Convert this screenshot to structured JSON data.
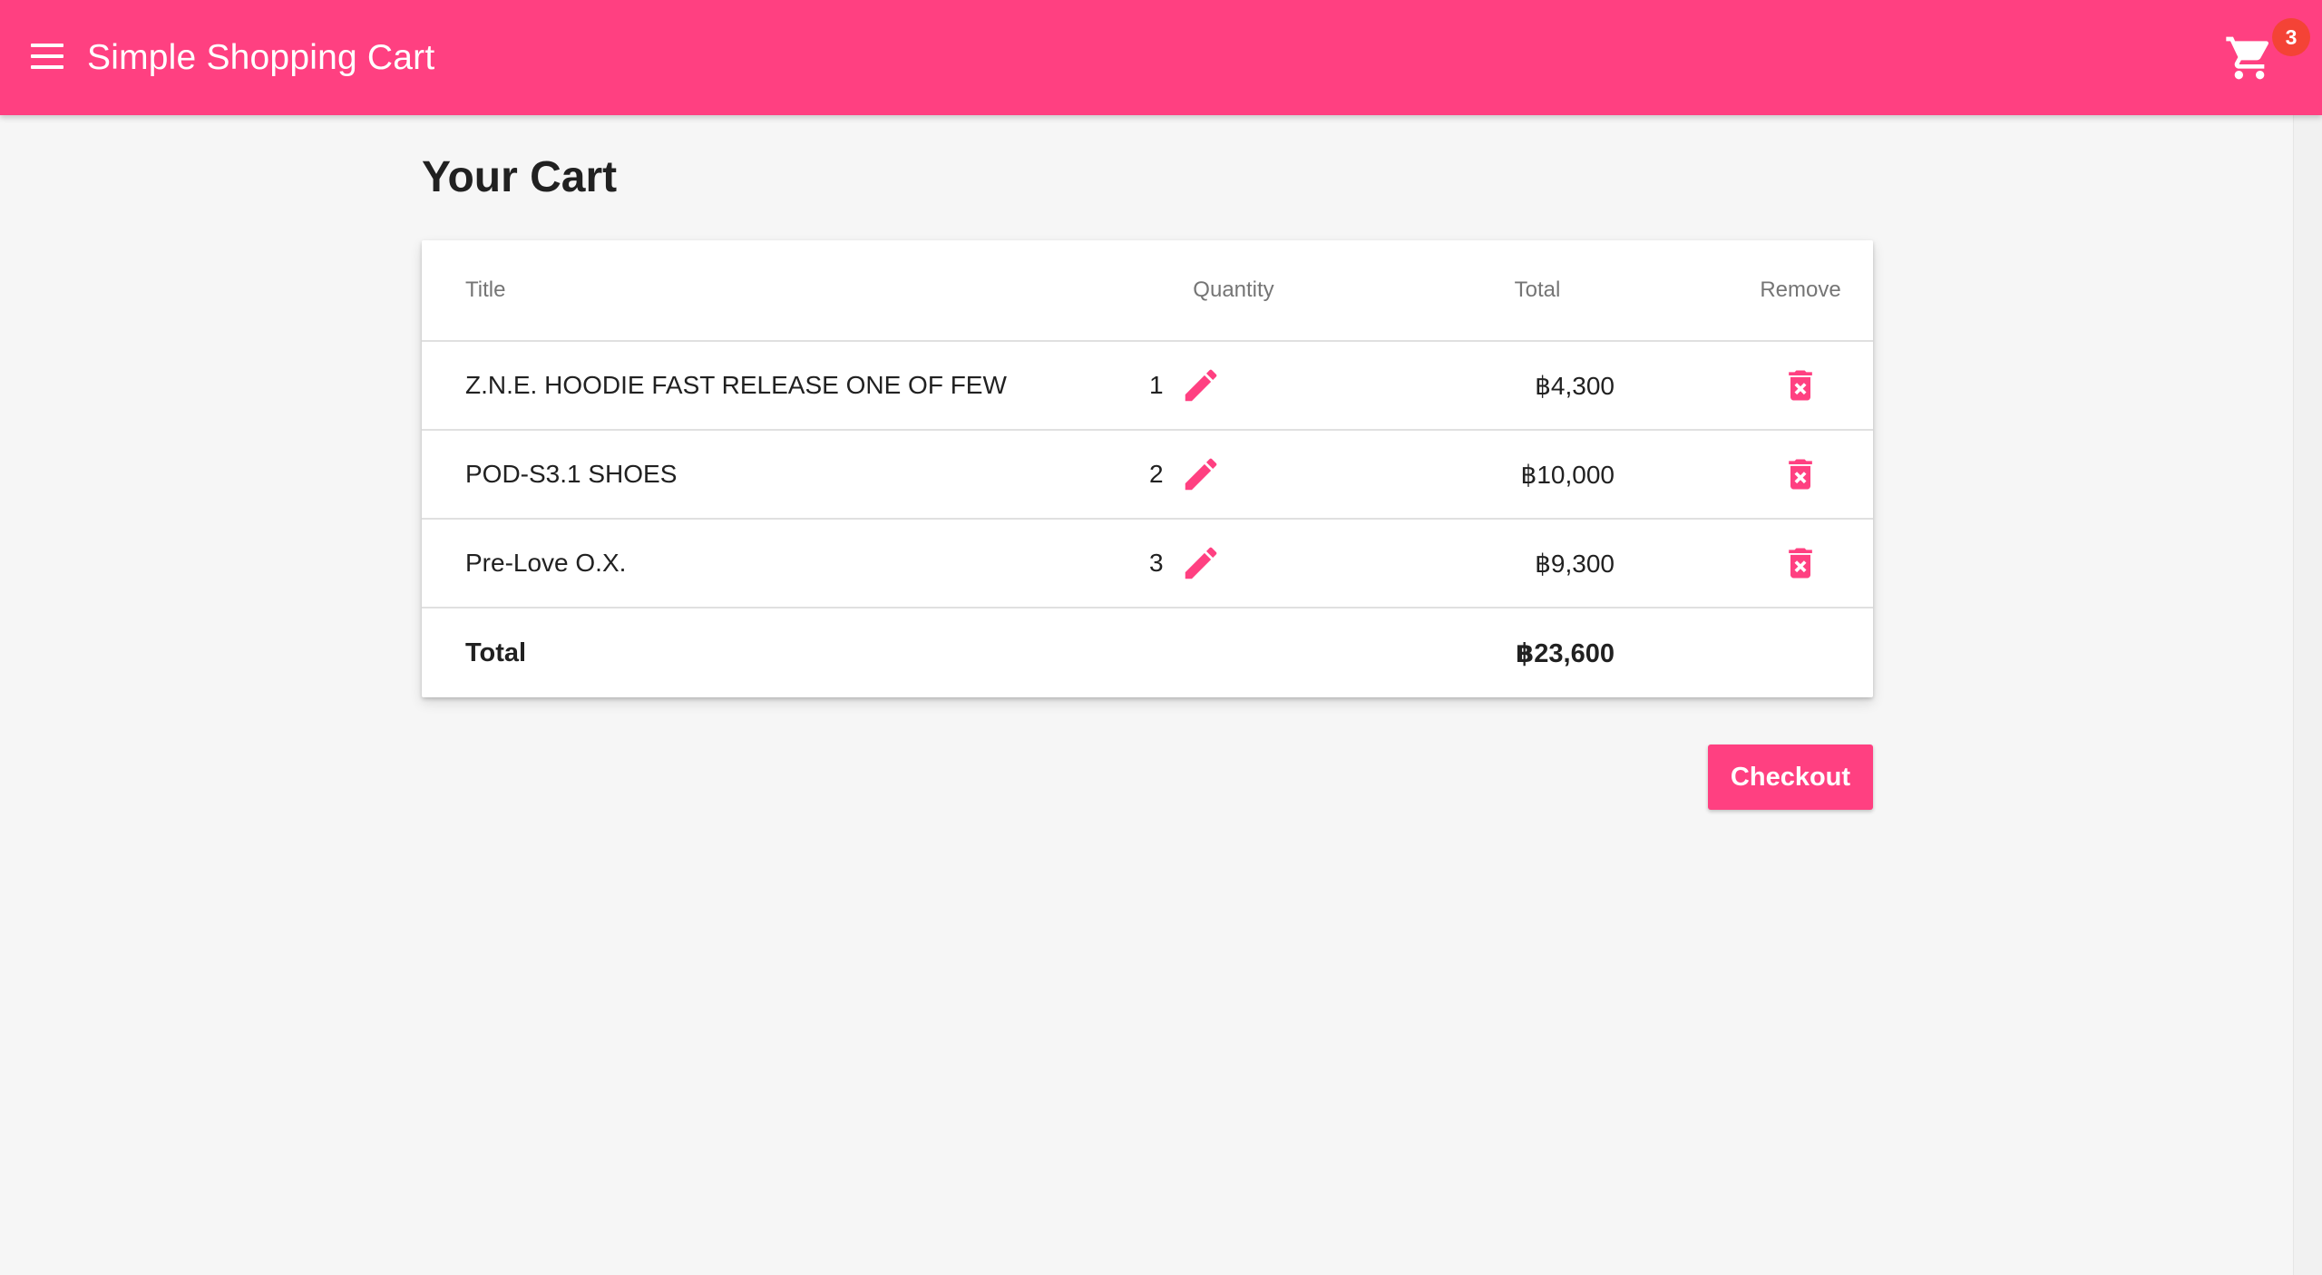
{
  "appbar": {
    "title": "Simple Shopping Cart",
    "cart_count": "3",
    "color": "#ff4081",
    "badge_color": "#f44336"
  },
  "page": {
    "title": "Your Cart"
  },
  "table": {
    "headers": {
      "title": "Title",
      "quantity": "Quantity",
      "total": "Total",
      "remove": "Remove"
    },
    "rows": [
      {
        "title": "Z.N.E. HOODIE FAST RELEASE ONE OF FEW",
        "quantity": "1",
        "total": "฿4,300"
      },
      {
        "title": "POD-S3.1 SHOES",
        "quantity": "2",
        "total": "฿10,000"
      },
      {
        "title": "Pre-Love O.X.",
        "quantity": "3",
        "total": "฿9,300"
      }
    ],
    "footer": {
      "label": "Total",
      "amount": "฿23,600"
    }
  },
  "actions": {
    "checkout_label": "Checkout"
  },
  "icons": {
    "menu": "menu-icon",
    "cart": "shopping-cart-icon",
    "edit": "pencil-icon",
    "remove": "trash-x-icon"
  }
}
